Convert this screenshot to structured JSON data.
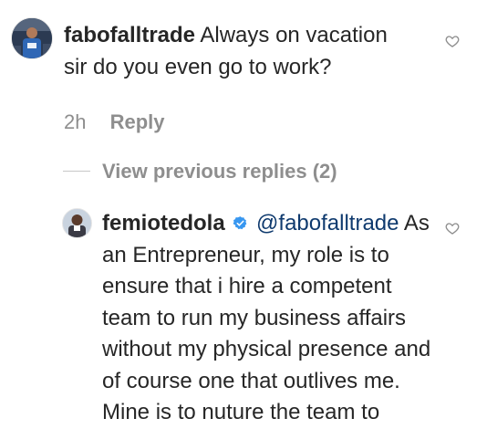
{
  "comments": [
    {
      "username": "fabofalltrade",
      "text": "Always on vacation sir do you even go to work?",
      "time": "2h",
      "reply_label": "Reply",
      "like_icon": "heart-outline-icon"
    },
    {
      "username": "femiotedola",
      "verified": true,
      "mention": "@fabofalltrade",
      "text": "As an Entrepreneur, my role is to ensure that i hire a competent team to run my business affairs without my physical presence and of course one that outlives me. Mine is to nuture the team to",
      "like_icon": "heart-outline-icon"
    }
  ],
  "view_previous_replies": "View previous replies (2)",
  "colors": {
    "text": "#262626",
    "muted": "#8e8e8e",
    "mention": "#0f3a6e",
    "verified": "#3897f0"
  }
}
